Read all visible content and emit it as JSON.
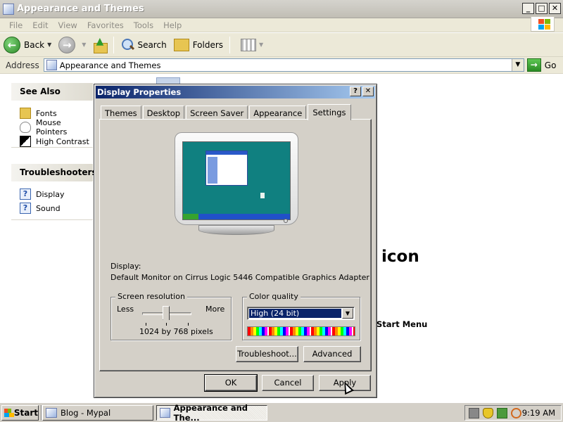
{
  "window": {
    "title": "Appearance and Themes",
    "buttons": [
      "_",
      "□",
      "✕"
    ]
  },
  "menu": [
    "File",
    "Edit",
    "View",
    "Favorites",
    "Tools",
    "Help"
  ],
  "toolbar": {
    "back_label": "Back",
    "search_label": "Search",
    "folders_label": "Folders"
  },
  "address": {
    "label": "Address",
    "value": "Appearance and Themes",
    "go_label": "Go"
  },
  "see_also": {
    "title": "See Also",
    "items": [
      "Fonts",
      "Mouse Pointers",
      "High Contrast"
    ]
  },
  "troubleshooters": {
    "title": "Troubleshooters",
    "items": [
      "Display",
      "Sound"
    ]
  },
  "content": {
    "text_icon": "icon",
    "text_start_menu": "Start Menu"
  },
  "dialog": {
    "title": "Display Properties",
    "help_btn": "?",
    "close_btn": "✕",
    "tabs": [
      "Themes",
      "Desktop",
      "Screen Saver",
      "Appearance",
      "Settings"
    ],
    "active_tab": "Settings",
    "display_label": "Display:",
    "display_value": "Default Monitor on Cirrus Logic 5446 Compatible Graphics Adapter",
    "resolution": {
      "legend": "Screen resolution",
      "less": "Less",
      "more": "More",
      "value": "1024 by 768 pixels"
    },
    "color": {
      "legend": "Color quality",
      "selected": "High (24 bit)"
    },
    "troubleshoot_btn": "Troubleshoot...",
    "advanced_btn": "Advanced",
    "ok_btn": "OK",
    "cancel_btn": "Cancel",
    "apply_btn": "Apply"
  },
  "taskbar": {
    "start_label": "Start",
    "items": [
      "Blog - Mypal",
      "Appearance and The..."
    ],
    "clock": "9:19 AM"
  }
}
